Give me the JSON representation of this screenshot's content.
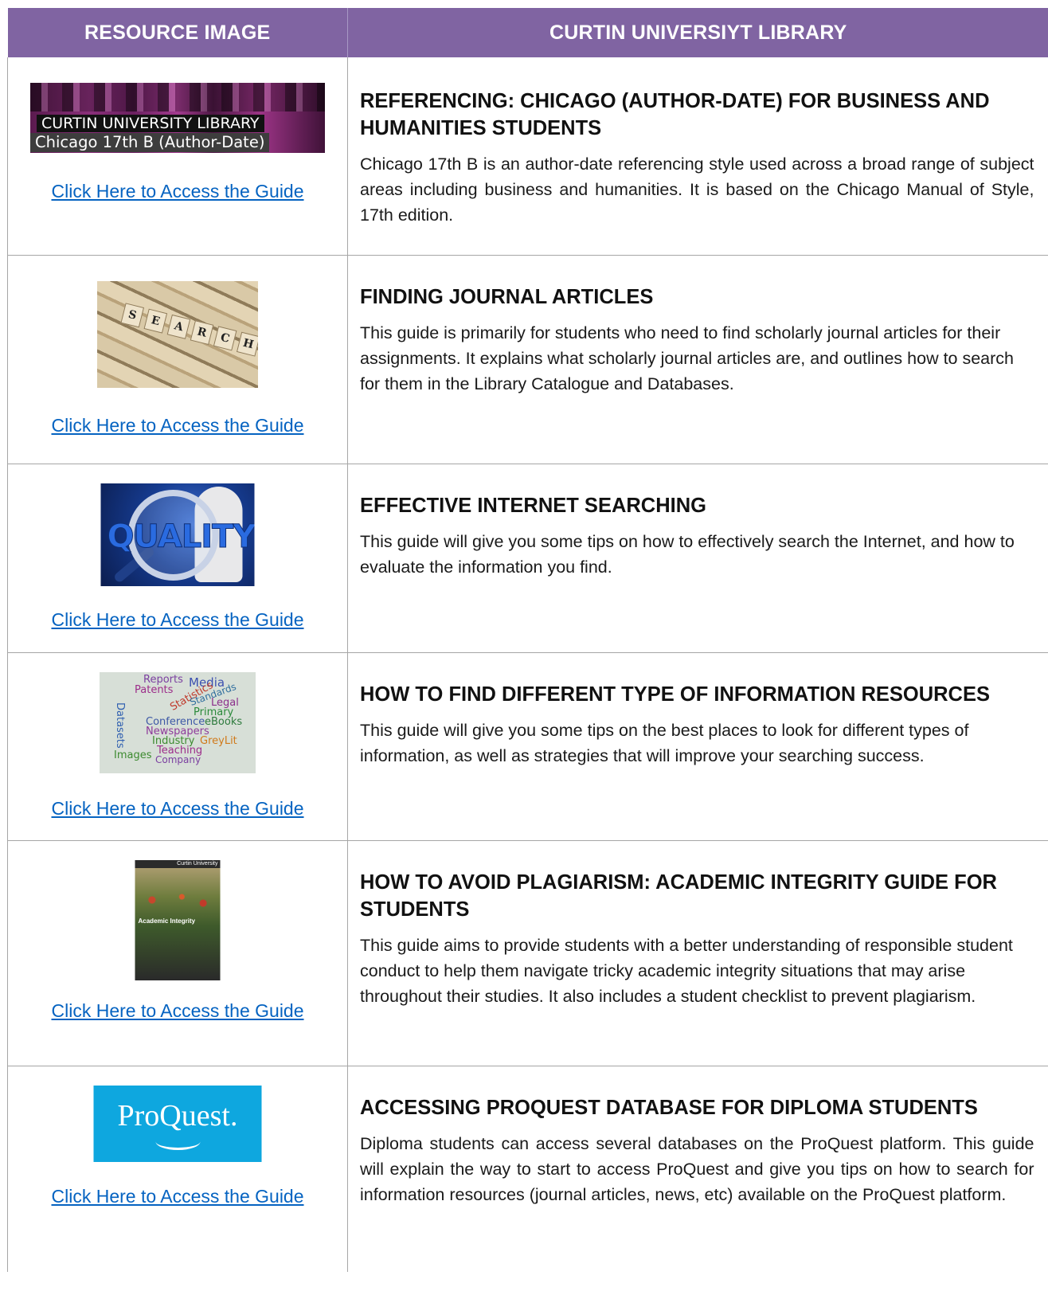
{
  "header": {
    "col1": "RESOURCE IMAGE",
    "col2": "CURTIN UNIVERSIYT LIBRARY"
  },
  "colors": {
    "header_bg": "#8064a2",
    "header_text": "#ffffff",
    "link": "#0563c1",
    "border": "#a6a6a6"
  },
  "rows": [
    {
      "image_alt_lines": [
        "CURTIN UNIVERSITY LIBRARY",
        "Chicago 17th B (Author-Date)"
      ],
      "link_text": "Click Here to Access the Guide",
      "title": "REFERENCING: CHICAGO (AUTHOR-DATE) FOR BUSINESS AND HUMANITIES STUDENTS",
      "body": "Chicago 17th B is an author-date referencing style used across a broad range of subject areas including business and humanities. It is based on the Chicago Manual of Style, 17th edition."
    },
    {
      "image_word": [
        "S",
        "E",
        "A",
        "R",
        "C",
        "H"
      ],
      "link_text": "Click Here to Access the Guide",
      "title": "FINDING JOURNAL ARTICLES",
      "body": "This guide is primarily for students who need to find scholarly journal articles for their assignments. It explains what scholarly journal articles are, and outlines how to search for them in the Library Catalogue and Databases."
    },
    {
      "image_word": "QUALITY",
      "link_text": "Click Here to Access the Guide",
      "title": "EFFECTIVE INTERNET SEARCHING",
      "body": "This guide will give you some tips on how to effectively search the Internet, and how to evaluate the information you find."
    },
    {
      "image_words": [
        "Reports",
        "Media",
        "Patents",
        "Statistics",
        "Standards",
        "Legal",
        "Primary",
        "Datasets",
        "Conference",
        "eBooks",
        "Newspapers",
        "Industry",
        "GreyLit",
        "Images",
        "Teaching",
        "Company"
      ],
      "link_text": "Click Here to Access the Guide",
      "title": "HOW TO FIND DIFFERENT TYPE OF INFORMATION RESOURCES",
      "body": "This guide will give you some tips on the best places to look for different types of information, as well as strategies that will improve your searching success."
    },
    {
      "image_text": {
        "brand": "Curtin University",
        "label": "Academic Integrity"
      },
      "link_text": "Click Here to Access the Guide",
      "title": "HOW TO AVOID PLAGIARISM: ACADEMIC INTEGRITY GUIDE FOR STUDENTS",
      "body": "This guide aims to provide students with a better understanding of responsible student conduct to help them navigate tricky academic integrity situations that may arise throughout their studies. It also includes a student checklist to prevent plagiarism."
    },
    {
      "image_text": "ProQuest.",
      "link_text": "Click Here to Access the Guide",
      "title": "ACCESSING PROQUEST DATABASE FOR DIPLOMA STUDENTS",
      "body": "Diploma students can access several databases on the ProQuest platform. This guide will explain the way to start to access ProQuest and give you tips on how to search for information resources (journal articles, news, etc) available on the ProQuest platform."
    }
  ]
}
